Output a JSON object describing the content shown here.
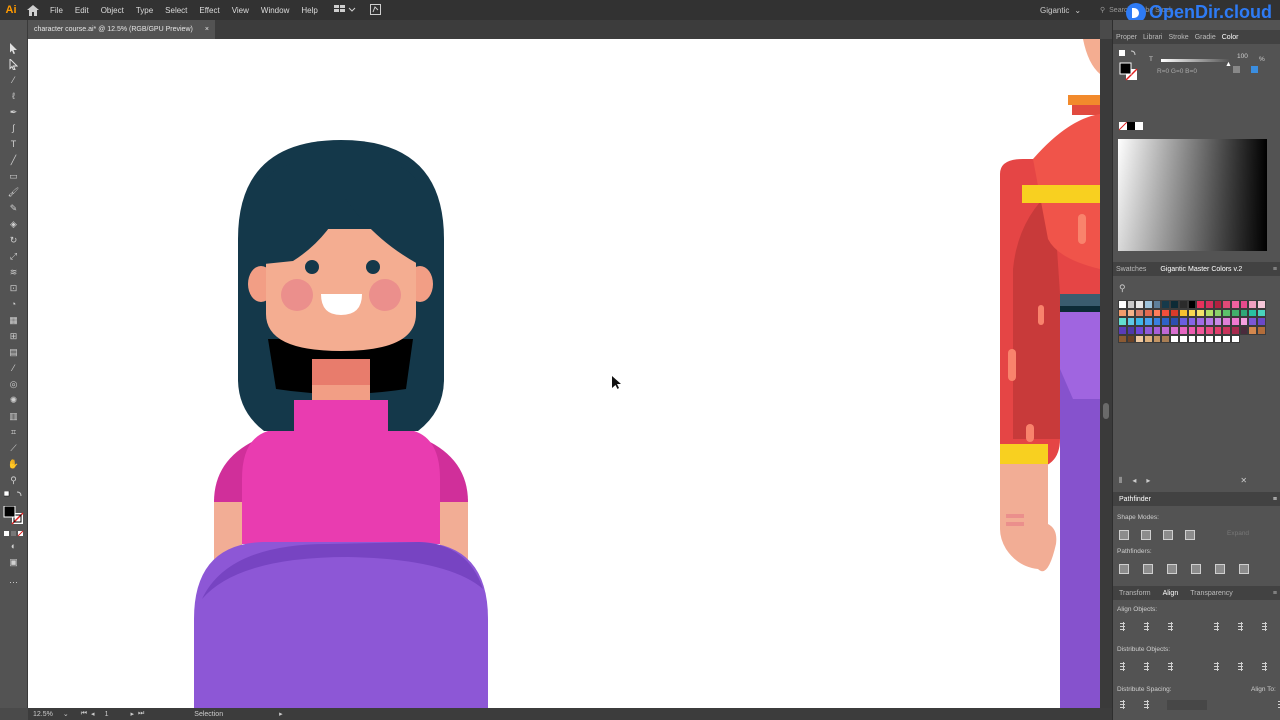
{
  "app": {
    "logo": "Ai",
    "menus": [
      "File",
      "Edit",
      "Object",
      "Type",
      "Select",
      "Effect",
      "View",
      "Window",
      "Help"
    ],
    "workspace": "Gigantic",
    "search_placeholder": "Search Adobe Stock",
    "watermark": "OpenDir.cloud"
  },
  "document": {
    "tab_label": "character course.ai* @ 12.5% (RGB/GPU Preview)",
    "close_glyph": "×"
  },
  "status": {
    "zoom": "12.5%",
    "artboard": "1",
    "tool": "Selection"
  },
  "color_panel": {
    "tabs": [
      "Proper",
      "Librari",
      "Stroke",
      "Gradie",
      "Color"
    ],
    "active_tab": "Color",
    "channel": "T",
    "value": "100",
    "percent": "%",
    "readout": "R=0 G=0 B=0"
  },
  "swatches_panel": {
    "tabs": [
      "Swatches",
      "Gigantic Master Colors v.2"
    ],
    "active_tab": "Gigantic Master Colors v.2",
    "colors": [
      "#ffffff",
      "#c8c8c8",
      "#e6e6e6",
      "#9ec3dc",
      "#5e7f9a",
      "#163a4b",
      "#0d2b36",
      "#2b2b2b",
      "#000000",
      "#e8325c",
      "#d6305e",
      "#b3213f",
      "#e04a77",
      "#f062a0",
      "#e84a8c",
      "#f0a0c0",
      "#f5c6d8",
      "#f39c6b",
      "#f3b38b",
      "#d7806a",
      "#e36a4f",
      "#ff7d5c",
      "#f24f3c",
      "#d93b2b",
      "#f6c230",
      "#f8d94f",
      "#f4e36a",
      "#b2df67",
      "#8ad16a",
      "#5cc16a",
      "#41b06b",
      "#2fa878",
      "#28c2a3",
      "#49d3bd",
      "#63ded0",
      "#5ec9e6",
      "#3db7ea",
      "#4aa2f0",
      "#3a7fe0",
      "#2e62c8",
      "#2c4fb0",
      "#6a5ee0",
      "#8565e8",
      "#a06ce6",
      "#b57ae8",
      "#c98ae6",
      "#e07fd8",
      "#f07ad0",
      "#f6a0e0",
      "#7c58d6",
      "#6a48c8",
      "#5a3cb8",
      "#4e3aa8",
      "#6d49d8",
      "#8f5bd9",
      "#a75fd8",
      "#c069d6",
      "#d86fd0",
      "#e666c1",
      "#ec5cb0",
      "#f0579a",
      "#e94b82",
      "#e03e6c",
      "#c9345c",
      "#a82a4e",
      "#4a2b3c",
      "#d4884e",
      "#b36d3a",
      "#8b5a33",
      "#6b4226",
      "#f0c9a0",
      "#ddb07c",
      "#c49564",
      "#a97e54",
      "#ffffff",
      "#ffffff",
      "#ffffff",
      "#ffffff",
      "#ffffff",
      "#ffffff",
      "#ffffff",
      "#ffffff"
    ]
  },
  "pathfinder": {
    "title": "Pathfinder",
    "shape_modes": "Shape Modes:",
    "pathfinders": "Pathfinders:",
    "expand": "Expand"
  },
  "align_panel": {
    "tabs": [
      "Transform",
      "Align",
      "Transparency"
    ],
    "active_tab": "Align",
    "align_objects": "Align Objects:",
    "distribute_objects": "Distribute Objects:",
    "distribute_spacing": "Distribute Spacing:",
    "align_to": "Align To:"
  }
}
